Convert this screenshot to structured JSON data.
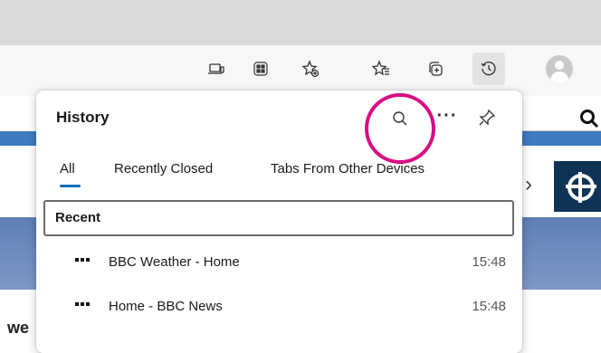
{
  "toolbar": {
    "icons": [
      "screen-cast-icon",
      "extensions-grid-icon",
      "add-favorite-icon",
      "favorites-icon",
      "collections-icon",
      "history-icon",
      "profile-avatar"
    ]
  },
  "history": {
    "title": "History",
    "tabs": [
      {
        "label": "All",
        "active": true
      },
      {
        "label": "Recently Closed",
        "active": false
      },
      {
        "label": "Tabs From Other Devices",
        "active": false
      }
    ],
    "section_label": "Recent",
    "items": [
      {
        "title": "BBC Weather - Home",
        "time": "15:48"
      },
      {
        "title": "Home - BBC News",
        "time": "15:48"
      }
    ]
  },
  "page": {
    "partial_text": "we"
  },
  "colors": {
    "highlight": "#d80b84",
    "accent": "#0f6cbd"
  }
}
